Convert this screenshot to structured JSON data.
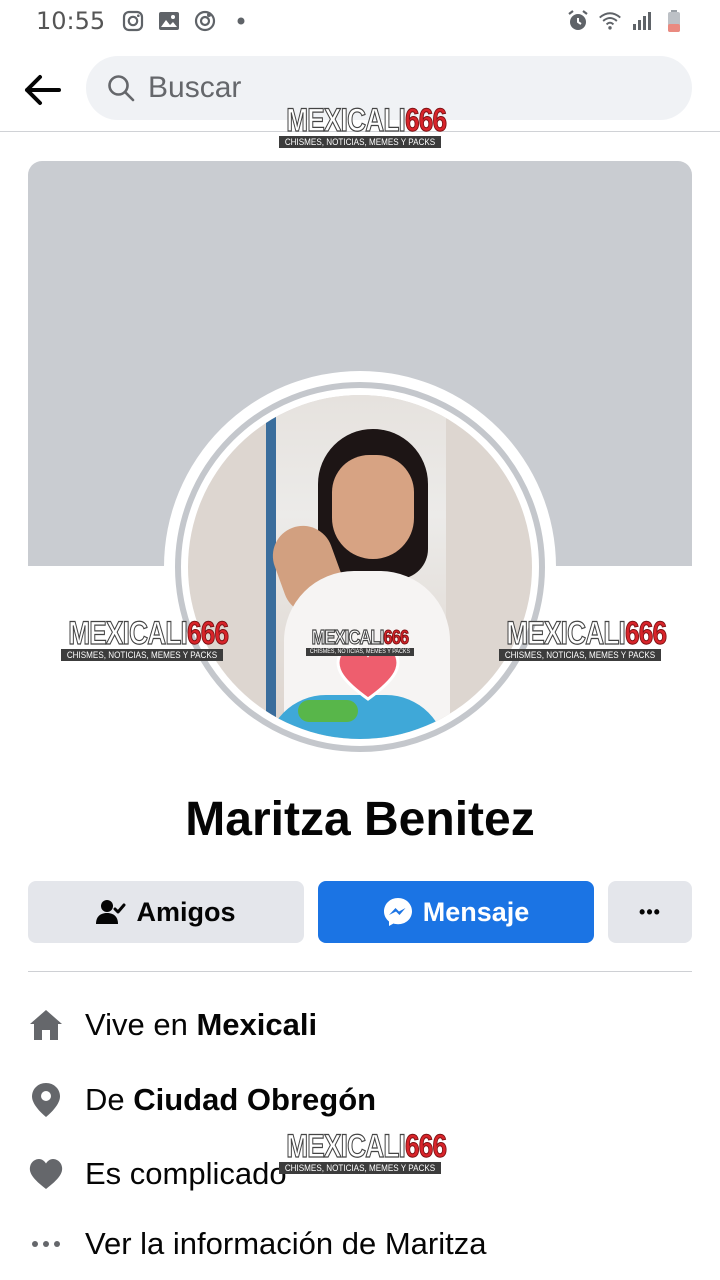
{
  "status_bar": {
    "time": "10:55",
    "left_icons": [
      "instagram-icon",
      "gallery-icon",
      "sync-icon",
      "dot-icon"
    ],
    "right_icons": [
      "alarm-icon",
      "wifi-icon",
      "signal-icon",
      "battery-icon"
    ]
  },
  "header": {
    "search_placeholder": "Buscar"
  },
  "watermark": {
    "brand_part1": "MEXICALI",
    "brand_part2": "666",
    "tagline": "CHISMES, NOTICIAS, MEMES Y PACKS"
  },
  "profile": {
    "name": "Maritza Benitez"
  },
  "actions": {
    "friends_label": "Amigos",
    "message_label": "Mensaje",
    "more_label": "•••"
  },
  "info": [
    {
      "icon": "home-icon",
      "prefix": "Vive en ",
      "bold": "Mexicali"
    },
    {
      "icon": "location-pin-icon",
      "prefix": "De ",
      "bold": "Ciudad Obregón"
    },
    {
      "icon": "heart-icon",
      "prefix": "Es complicado",
      "bold": ""
    },
    {
      "icon": "more-dots-icon",
      "prefix": "Ver la información de Maritza",
      "bold": ""
    }
  ],
  "colors": {
    "primary_blue": "#1b74e4",
    "cover_gray": "#c9ccd1",
    "button_gray": "#e4e6eb",
    "icon_gray": "#65676b"
  }
}
